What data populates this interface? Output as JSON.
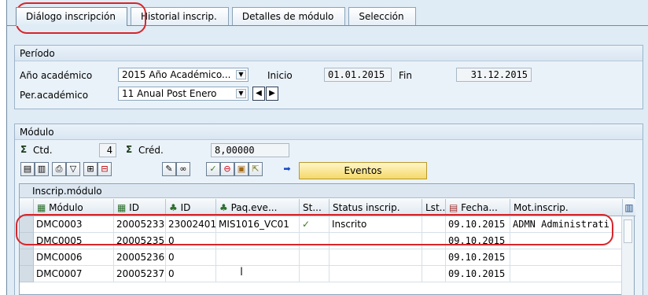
{
  "tabs": [
    "Diálogo inscripción",
    "Historial inscrip.",
    "Detalles de módulo",
    "Selección"
  ],
  "periodo": {
    "title": "Período",
    "ano_label": "Año académico",
    "ano_value": "2015 Año Académico...",
    "inicio_label": "Inicio",
    "inicio_value": "01.01.2015",
    "fin_label": "Fin",
    "fin_value": "31.12.2015",
    "per_label": "Per.académico",
    "per_value": "11 Anual Post Enero"
  },
  "modulo": {
    "title": "Módulo",
    "ctd_label": "Ctd.",
    "ctd_value": "4",
    "cred_label": "Créd.",
    "cred_value": "8,00000",
    "eventos_label": "Eventos"
  },
  "table": {
    "title": "Inscrip.módulo",
    "columns": [
      "Módulo",
      "ID",
      "ID",
      "Paq.eve...",
      "St...",
      "Status inscrip.",
      "Lst...",
      "Fecha...",
      "Mot.inscrip."
    ],
    "rows": [
      {
        "modulo": "DMC0003",
        "id1": "20005233",
        "id2": "23002401",
        "paq": "MIS1016_VC01",
        "status": "Inscrito",
        "fecha": "09.10.2015",
        "mot": "ADMN Administrati"
      },
      {
        "modulo": "DMC0005",
        "id1": "20005235",
        "id2": "0",
        "paq": "",
        "status": "",
        "fecha": "09.10.2015",
        "mot": ""
      },
      {
        "modulo": "DMC0006",
        "id1": "20005236",
        "id2": "0",
        "paq": "",
        "status": "",
        "fecha": "09.10.2015",
        "mot": ""
      },
      {
        "modulo": "DMC0007",
        "id1": "20005237",
        "id2": "0",
        "paq": "",
        "status": "",
        "fecha": "09.10.2015",
        "mot": ""
      }
    ]
  },
  "icons": {
    "sigma": "Σ",
    "tree": "♣",
    "grid": "▦",
    "calendar": "▤",
    "settings": "▥",
    "arrow": "➡"
  },
  "colors": {
    "highlight_oval": "#d6262a",
    "frame": "#dfebf5"
  }
}
